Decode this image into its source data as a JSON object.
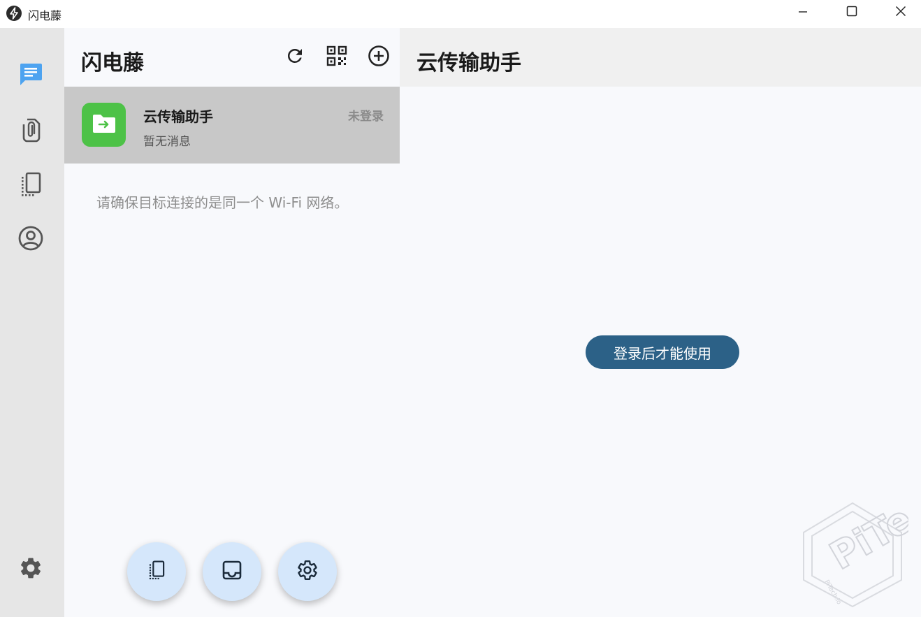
{
  "window": {
    "title": "闪电藤",
    "icons": {
      "logo": "lightning-bolt-icon",
      "minimize": "minimize-icon",
      "maximize": "maximize-icon",
      "close": "close-icon"
    }
  },
  "rail": {
    "items": [
      {
        "name": "messages",
        "icon": "chat-bubble-icon",
        "active": true
      },
      {
        "name": "files",
        "icon": "attachment-clip-icon",
        "active": false
      },
      {
        "name": "clipboard",
        "icon": "device-copy-icon",
        "active": false
      },
      {
        "name": "account",
        "icon": "account-circle-icon",
        "active": false
      }
    ],
    "settings_icon": "gear-icon",
    "active_color": "#4da3f0"
  },
  "list": {
    "title": "闪电藤",
    "actions": [
      "refresh-icon",
      "qr-code-icon",
      "add-circle-icon"
    ],
    "chat": {
      "name": "云传输助手",
      "last_message": "暂无消息",
      "status": "未登录",
      "avatar_icon": "folder-transfer-icon",
      "avatar_color": "#4dc247"
    },
    "wifi_tip": "请确保目标连接的是同一个 Wi-Fi 网络。",
    "fabs": [
      "device-copy-icon",
      "inbox-tray-icon",
      "gear-icon"
    ]
  },
  "panel": {
    "title": "云传输助手",
    "login_button": "登录后才能使用",
    "button_color": "#2c6187"
  },
  "watermark": {
    "text": "PiTech",
    "domain": "PiTech.io"
  }
}
